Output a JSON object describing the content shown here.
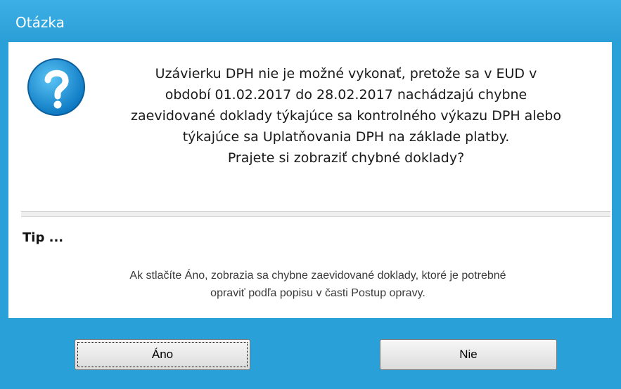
{
  "window": {
    "title": "Otázka"
  },
  "message": {
    "lines": [
      "Uzávierku DPH nie je možné vykonať, pretože sa v EUD v",
      "období 01.02.2017 do 28.02.2017 nachádzajú chybne",
      "zaevidované doklady týkajúce sa kontrolného výkazu DPH alebo",
      "týkajúce sa Uplatňovania DPH na základe platby.",
      "Prajete si zobraziť chybné doklady?"
    ]
  },
  "tip": {
    "label": "Tip ...",
    "lines": [
      "Ak stlačíte Áno, zobrazia sa chybne zaevidované doklady, ktoré je potrebné",
      "opraviť podľa popisu v časti Postup opravy."
    ]
  },
  "buttons": {
    "yes_label": "Áno",
    "no_label": "Nie"
  },
  "colors": {
    "frame": "#2aa0d8",
    "icon": "#1e8fd0"
  },
  "icons": {
    "dialog_icon": "question-icon"
  }
}
